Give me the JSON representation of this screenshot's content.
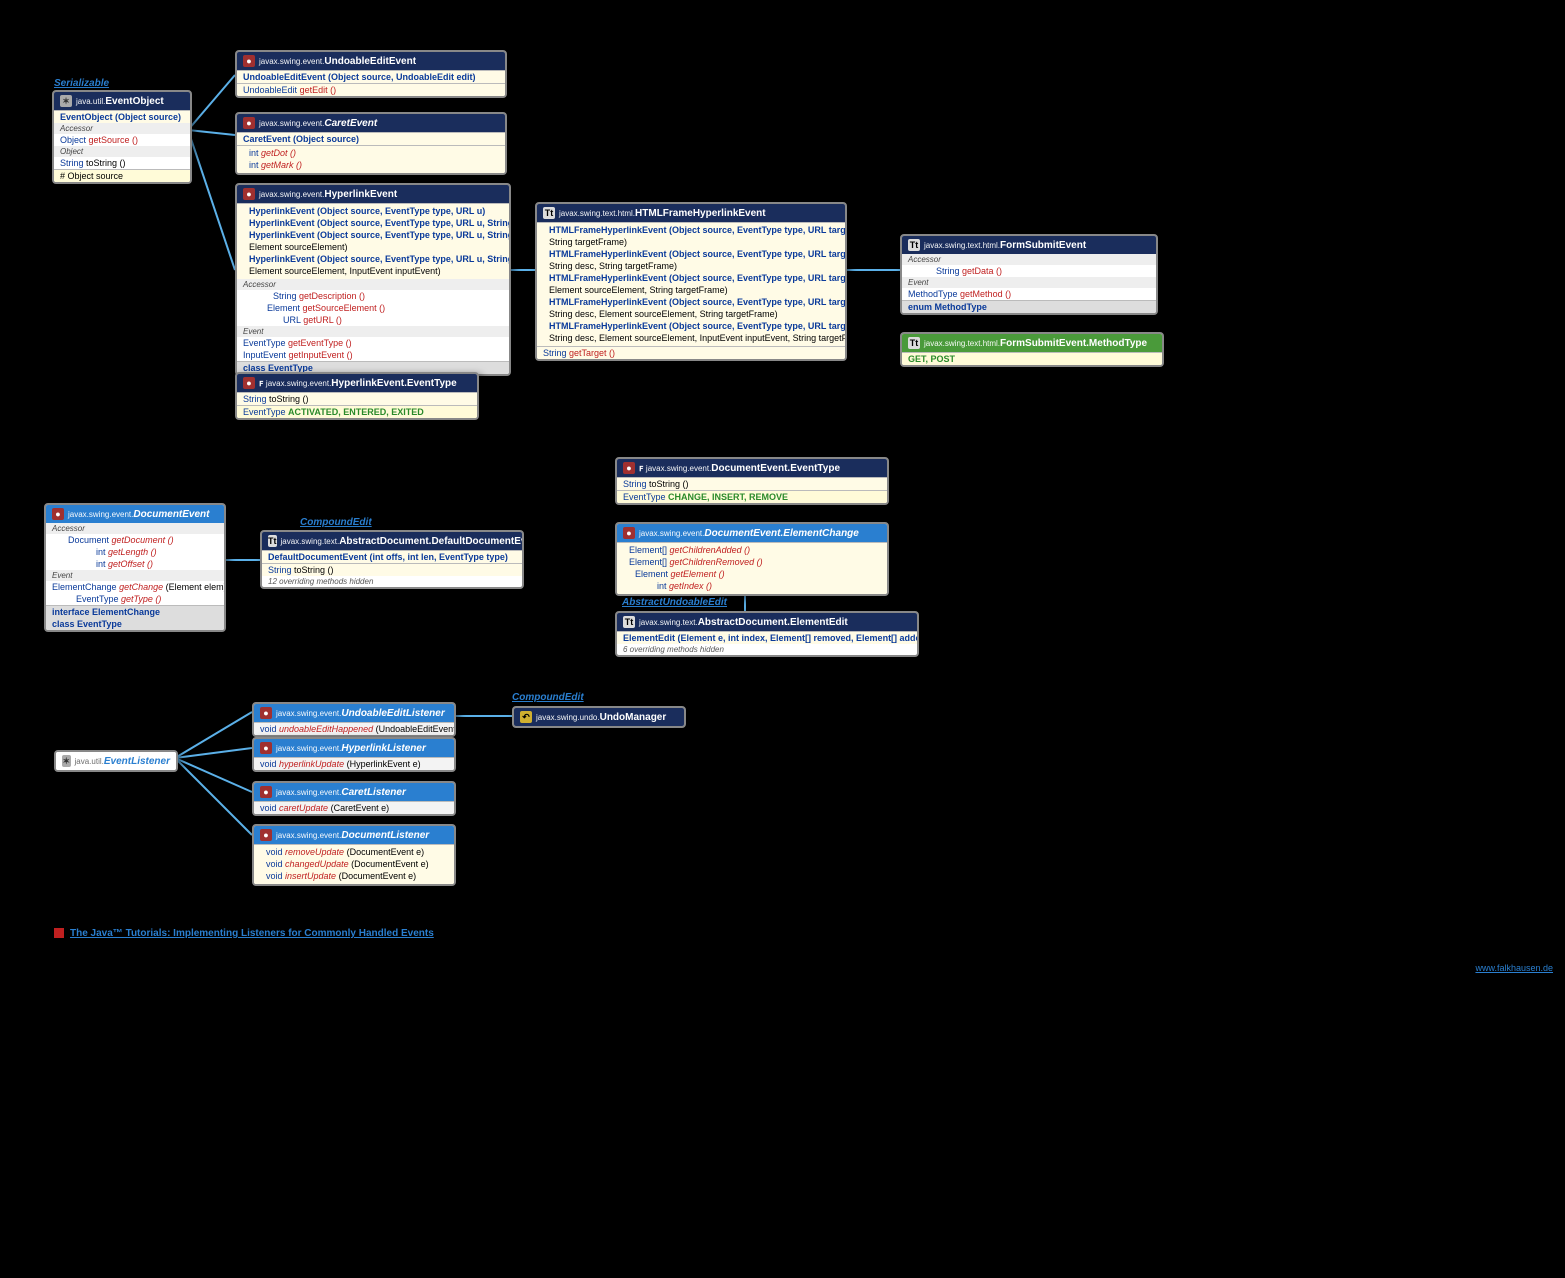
{
  "labels": {
    "serializable": "Serializable",
    "compound1": "CompoundEdit",
    "compound2": "CompoundEdit",
    "abstractUndo": "AbstractUndoableEdit"
  },
  "ext": {
    "tutorial": "The Java™ Tutorials: Implementing Listeners for Commonly Handled Events",
    "footer": "www.falkhausen.de"
  },
  "eventObject": {
    "pkg": "java.util.",
    "cls": "EventObject",
    "ctor": "EventObject (Object source)",
    "acc": "Accessor",
    "m1t": "Object",
    "m1": "getSource ()",
    "m2t": "Object",
    "m3t": "String",
    "m3": "toString ()",
    "f": "# Object  source"
  },
  "undoEvent": {
    "pkg": "javax.swing.event.",
    "cls": "UndoableEditEvent",
    "ctor": "UndoableEditEvent (Object source, UndoableEdit edit)",
    "m1t": "UndoableEdit",
    "m1": "getEdit ()"
  },
  "caretEvent": {
    "pkg": "javax.swing.event.",
    "cls": "CaretEvent",
    "ctor": "CaretEvent (Object source)",
    "m1t": "int",
    "m1": "getDot ()",
    "m2t": "int",
    "m2": "getMark ()"
  },
  "hyperEvent": {
    "pkg": "javax.swing.event.",
    "cls": "HyperlinkEvent",
    "c1": "HyperlinkEvent (Object source, EventType type, URL u)",
    "c2": "HyperlinkEvent (Object source, EventType type, URL u, String desc)",
    "c3a": "HyperlinkEvent (Object source, EventType type, URL u, String desc,",
    "c3b": "            Element sourceElement)",
    "c4a": "HyperlinkEvent (Object source, EventType type, URL u, String desc,",
    "c4b": "            Element sourceElement, InputEvent inputEvent)",
    "acc": "Accessor",
    "a1t": "String",
    "a1": "getDescription ()",
    "a2t": "Element",
    "a2": "getSourceElement ()",
    "a3t": "URL",
    "a3": "getURL ()",
    "ev": "Event",
    "e1t": "EventType",
    "e1": "getEventType ()",
    "e2t": "InputEvent",
    "e2": "getInputEvent ()",
    "inner": "class EventType"
  },
  "hyperType": {
    "pkg": "javax.swing.event.",
    "cls": "HyperlinkEvent.EventType",
    "m1t": "String",
    "m1": "toString ()",
    "c": "EventType",
    "cv": "ACTIVATED, ENTERED, EXITED"
  },
  "htmlFrame": {
    "pkg": "javax.swing.text.html.",
    "cls": "HTMLFrameHyperlinkEvent",
    "c1a": "HTMLFrameHyperlinkEvent (Object source, EventType type, URL targetURL,",
    "c1b": "            String targetFrame)",
    "c2a": "HTMLFrameHyperlinkEvent (Object source, EventType type, URL targetURL,",
    "c2b": "            String desc, String targetFrame)",
    "c3a": "HTMLFrameHyperlinkEvent (Object source, EventType type, URL targetURL,",
    "c3b": "            Element sourceElement, String targetFrame)",
    "c4a": "HTMLFrameHyperlinkEvent (Object source, EventType type, URL targetURL,",
    "c4b": "            String desc, Element sourceElement, String targetFrame)",
    "c5a": "HTMLFrameHyperlinkEvent (Object source, EventType type, URL targetURL,",
    "c5b": "            String desc, Element sourceElement, InputEvent inputEvent, String targetFrame)",
    "m1t": "String",
    "m1": "getTarget ()"
  },
  "formSubmit": {
    "pkg": "javax.swing.text.html.",
    "cls": "FormSubmitEvent",
    "acc": "Accessor",
    "a1t": "String",
    "a1": "getData ()",
    "ev": "Event",
    "e1t": "MethodType",
    "e1": "getMethod ()",
    "inner": "enum MethodType"
  },
  "formType": {
    "pkg": "javax.swing.text.html.",
    "cls": "FormSubmitEvent.MethodType",
    "cv": "GET, POST"
  },
  "docEvent": {
    "pkg": "javax.swing.event.",
    "cls": "DocumentEvent",
    "acc": "Accessor",
    "a1t": "Document",
    "a1": "getDocument ()",
    "a2t": "int",
    "a2": "getLength ()",
    "a3t": "int",
    "a3": "getOffset ()",
    "ev": "Event",
    "e1t": "ElementChange",
    "e1": "getChange",
    "e1p": "(Element elem)",
    "e2t": "EventType",
    "e2": "getType ()",
    "i1": "interface ElementChange",
    "i2": "class EventType"
  },
  "defaultDoc": {
    "pkg": "javax.swing.text.",
    "cls": "AbstractDocument.DefaultDocumentEvent",
    "ctor": "DefaultDocumentEvent (int offs, int len, EventType type)",
    "m1t": "String",
    "m1": "toString ()",
    "ov": "12 overriding methods hidden"
  },
  "docType": {
    "pkg": "javax.swing.event.",
    "cls": "DocumentEvent.EventType",
    "m1t": "String",
    "m1": "toString ()",
    "c": "EventType",
    "cv": "CHANGE, INSERT, REMOVE"
  },
  "elemChange": {
    "pkg": "javax.swing.event.",
    "cls": "DocumentEvent.ElementChange",
    "m1t": "Element[]",
    "m1": "getChildrenAdded ()",
    "m2t": "Element[]",
    "m2": "getChildrenRemoved ()",
    "m3t": "Element",
    "m3": "getElement ()",
    "m4t": "int",
    "m4": "getIndex ()"
  },
  "elemEdit": {
    "pkg": "javax.swing.text.",
    "cls": "AbstractDocument.ElementEdit",
    "ctor": "ElementEdit (Element e, int index, Element[] removed, Element[] added)",
    "ov": "6 overriding methods hidden"
  },
  "eventListener": {
    "pkg": "java.util.",
    "cls": "EventListener"
  },
  "undoL": {
    "pkg": "javax.swing.event.",
    "cls": "UndoableEditListener",
    "m1t": "void",
    "m1": "undoableEditHappened",
    "m1p": "(UndoableEditEvent e)"
  },
  "hyperL": {
    "pkg": "javax.swing.event.",
    "cls": "HyperlinkListener",
    "m1t": "void",
    "m1": "hyperlinkUpdate",
    "m1p": "(HyperlinkEvent e)"
  },
  "caretL": {
    "pkg": "javax.swing.event.",
    "cls": "CaretListener",
    "m1t": "void",
    "m1": "caretUpdate",
    "m1p": "(CaretEvent e)"
  },
  "docL": {
    "pkg": "javax.swing.event.",
    "cls": "DocumentListener",
    "m1t": "void",
    "m1": "removeUpdate",
    "m1p": "(DocumentEvent e)",
    "m2t": "void",
    "m2": "changedUpdate",
    "m2p": "(DocumentEvent e)",
    "m3t": "void",
    "m3": "insertUpdate",
    "m3p": "(DocumentEvent e)"
  },
  "undoMgr": {
    "pkg": "javax.swing.undo.",
    "cls": "UndoManager"
  }
}
